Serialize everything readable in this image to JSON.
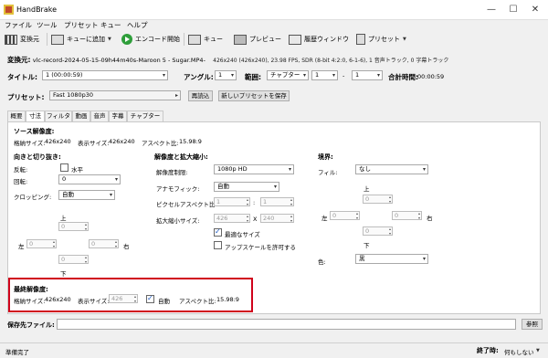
{
  "window": {
    "title": "HandBrake",
    "min": "—",
    "max": "☐",
    "close": "✕"
  },
  "menu": [
    "ファイル",
    "ツール",
    "プリセット",
    "キュー",
    "ヘルプ"
  ],
  "toolbar": {
    "source": "変換元",
    "add_queue": "キューに追加",
    "start": "エンコード開始",
    "queue": "キュー",
    "preview": "プレビュー",
    "activity": "履歴ウィンドウ",
    "presets": "プリセット"
  },
  "source": {
    "label": "変換元:",
    "name": "vlc-record-2024-05-15-09h44m40s-Maroon 5 - Sugar.MP4-",
    "info": "426x240 (426x240), 23.98 FPS, SDR (8-bit 4:2:0, 6-1-6), 1 音声トラック, 0 字幕トラック"
  },
  "title_row": {
    "title_label": "タイトル:",
    "title_value": "1 (00:00:59)",
    "angle_label": "アングル:",
    "angle_value": "1",
    "range_label": "範囲:",
    "range_type": "チャプター",
    "range_from": "1",
    "range_dash": "-",
    "range_to": "1",
    "duration_label": "合計時間:",
    "duration_value": "00:00:59"
  },
  "preset_row": {
    "label": "プリセット:",
    "value": "Fast 1080p30",
    "reload": "再読込",
    "save_new": "新しいプリセットを保存"
  },
  "tabs": [
    "概要",
    "寸法",
    "フィルタ",
    "動画",
    "音声",
    "字幕",
    "チャプター"
  ],
  "active_tab": 1,
  "dimensions": {
    "source_title": "ソース解像度:",
    "storage_label": "格納サイズ:",
    "storage_value": "426x240",
    "display_label": "表示サイズ:",
    "display_value": "426x240",
    "aspect_label": "アスペクト比:",
    "aspect_value": "15.98:9",
    "orient_title": "向きと切り抜き:",
    "flip_label": "反転:",
    "flip_checkbox": "水平",
    "rotate_label": "回転:",
    "rotate_value": "0",
    "crop_label": "クロッピング:",
    "crop_value": "自動",
    "crop_top_label": "上",
    "crop_top": "0",
    "crop_left_label": "左",
    "crop_left": "0",
    "crop_right": "0",
    "crop_right_label": "右",
    "crop_bottom": "0",
    "crop_bottom_label": "下",
    "scale_title": "解像度と拡大縮小:",
    "res_limit_label": "解像度制限:",
    "res_limit_value": "1080p HD",
    "anamorphic_label": "アナモフィック:",
    "anamorphic_value": "自動",
    "par_label": "ピクセルアスペクト比:",
    "par_x": "1",
    "par_sep": ":",
    "par_y": "1",
    "scaled_label": "拡大縮小サイズ:",
    "scaled_w": "426",
    "scaled_x": "X",
    "scaled_h": "240",
    "optimal_label": "最適なサイズ",
    "upscale_label": "アップスケールを許可する",
    "border_title": "境界:",
    "fill_label": "フィル:",
    "fill_value": "なし",
    "border_top_label": "上",
    "border_top": "0",
    "border_left_label": "左",
    "border_left": "0",
    "border_right": "0",
    "border_right_label": "右",
    "border_bottom": "0",
    "border_bottom_label": "下",
    "color_label": "色:",
    "color_value": "黒",
    "final_title": "最終解像度:",
    "final_storage_label": "格納サイズ:",
    "final_storage_value": "426x240",
    "final_display_label": "表示サイズ:",
    "final_display_value": "426",
    "final_auto_label": "自動",
    "final_aspect_label": "アスペクト比:",
    "final_aspect_value": "15.98:9"
  },
  "destination": {
    "label": "保存先ファイル:",
    "value": "",
    "browse": "参照"
  },
  "status": {
    "left": "準備完了",
    "when_done_label": "終了時:",
    "when_done_value": "何もしない"
  },
  "colors": {
    "highlight_box": "#d0021b",
    "start_icon": "#2e9e3a",
    "check": "#1a57c0"
  }
}
